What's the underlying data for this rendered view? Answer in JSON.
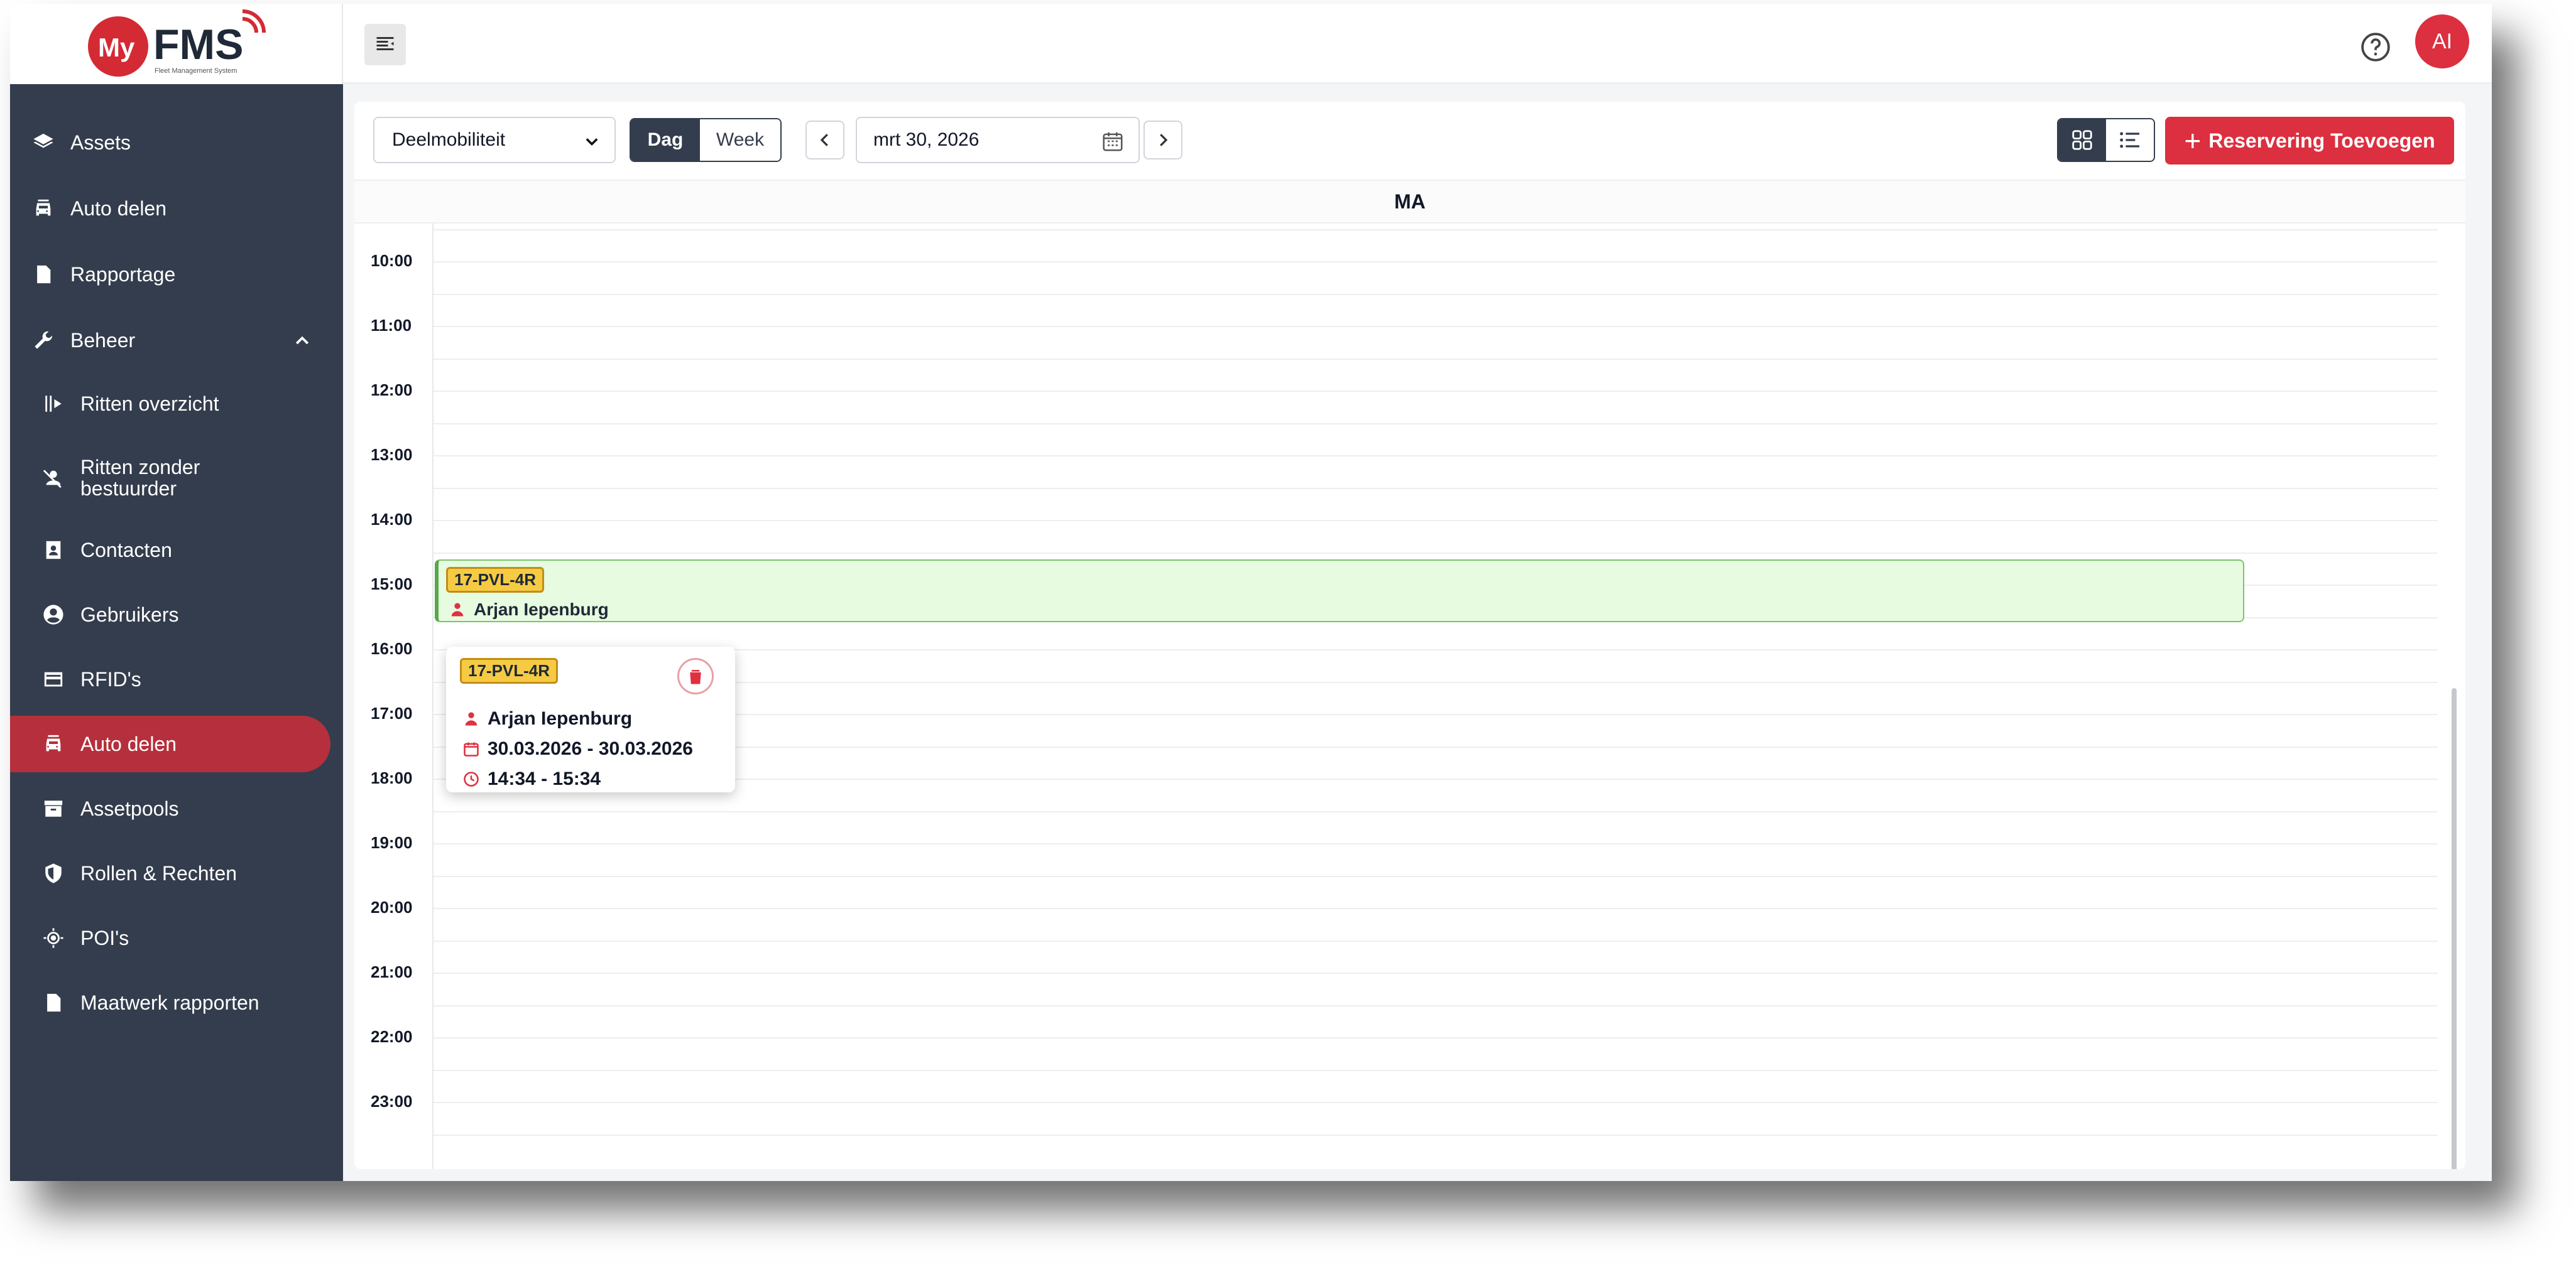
{
  "app": {
    "logo_text": "MyFMS",
    "logo_subtitle": "Fleet Management System"
  },
  "sidebar": {
    "items": [
      {
        "label": "Assets",
        "icon": "layers-icon"
      },
      {
        "label": "Auto delen",
        "icon": "car-share-icon"
      },
      {
        "label": "Rapportage",
        "icon": "document-icon"
      },
      {
        "label": "Beheer",
        "icon": "wrench-icon",
        "expanded": true
      },
      {
        "label": "Ritten overzicht",
        "icon": "trips-icon"
      },
      {
        "label": "Ritten zonder bestuurder",
        "icon": "no-driver-icon"
      },
      {
        "label": "Contacten",
        "icon": "contacts-icon"
      },
      {
        "label": "Gebruikers",
        "icon": "user-circle-icon"
      },
      {
        "label": "RFID's",
        "icon": "card-icon"
      },
      {
        "label": "Auto delen",
        "icon": "car-share-icon",
        "active": true
      },
      {
        "label": "Assetpools",
        "icon": "archive-icon"
      },
      {
        "label": "Rollen & Rechten",
        "icon": "shield-icon"
      },
      {
        "label": "POI's",
        "icon": "target-icon"
      },
      {
        "label": "Maatwerk rapporten",
        "icon": "file-icon"
      }
    ]
  },
  "topbar": {
    "avatar_initials": "AI"
  },
  "toolbar": {
    "category_select": "Deelmobiliteit",
    "view_day": "Dag",
    "view_week": "Week",
    "date_value": "mrt 30, 2026",
    "add_button": "Reservering Toevoegen"
  },
  "calendar": {
    "day_label": "MA",
    "hours": [
      "10:00",
      "11:00",
      "12:00",
      "13:00",
      "14:00",
      "15:00",
      "16:00",
      "17:00",
      "18:00",
      "19:00",
      "20:00",
      "21:00",
      "22:00",
      "23:00"
    ],
    "event": {
      "plate": "17-PVL-4R",
      "driver": "Arjan Iepenburg"
    },
    "popover": {
      "plate": "17-PVL-4R",
      "driver": "Arjan Iepenburg",
      "dates": "30.03.2026 - 30.03.2026",
      "times": "14:34 - 15:34"
    }
  },
  "colors": {
    "sidebar_bg": "#343d4d",
    "active_item": "#b5303c",
    "accent_red": "#dc2f3f",
    "event_bg": "#e6fbdf",
    "plate_yellow": "#f6cb43"
  }
}
